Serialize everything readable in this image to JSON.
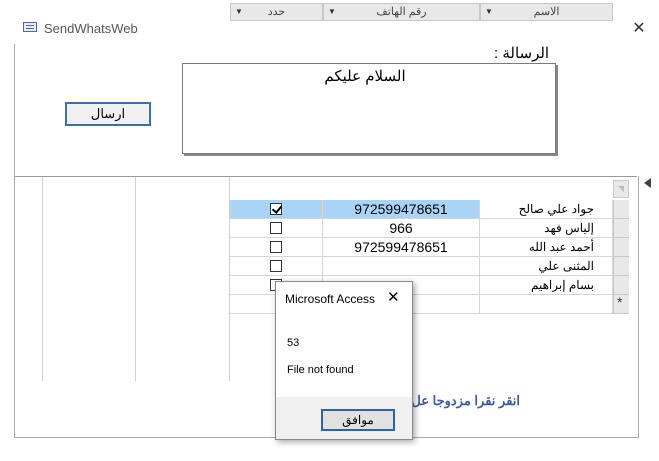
{
  "window": {
    "title": "SendWhatsWeb",
    "close": "✕"
  },
  "form": {
    "message_label": "الرسالة :",
    "message_text": "السلام عليكم",
    "send_label": "ارسال",
    "hint": "انقر  نقرا مزدوجا عل             الكل ومرة أخرى للإلغاء"
  },
  "grid": {
    "headers": {
      "select": "حدد",
      "phone": "رقم الهاتف",
      "name": "الاسم"
    },
    "rows": [
      {
        "checked": true,
        "phone": "972599478651",
        "name": "جواد علي صالح"
      },
      {
        "checked": false,
        "phone": "966",
        "name": "إلياس فهد"
      },
      {
        "checked": false,
        "phone": "972599478651",
        "name": "أحمد عبد الله"
      },
      {
        "checked": false,
        "phone": "",
        "name": "المثنى علي"
      },
      {
        "checked": false,
        "phone": "",
        "name": "بسام إبراهيم"
      }
    ],
    "new_row_marker": "*"
  },
  "dialog": {
    "title": "Microsoft Access",
    "close": "✕",
    "number": "53",
    "message": "File not found",
    "ok_label": "موافق"
  }
}
